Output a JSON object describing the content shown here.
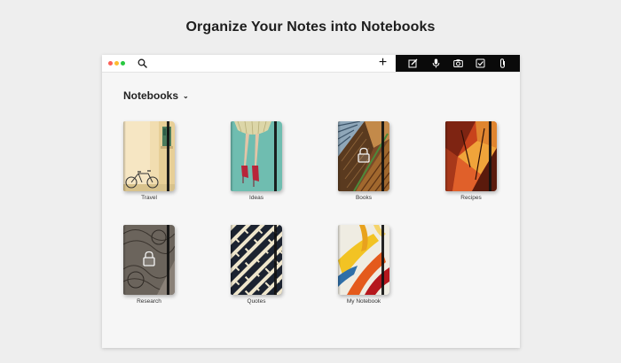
{
  "headline": "Organize Your Notes into Notebooks",
  "colors": {
    "accent_red": "#fc5f57",
    "accent_yellow": "#fdbc2e",
    "accent_green": "#28c840",
    "toolbar_bg": "#0a0a0a"
  },
  "toolbar": {
    "search_icon": "search-icon",
    "add_label": "+",
    "actions": [
      "new-note-icon",
      "microphone-icon",
      "camera-icon",
      "checklist-icon",
      "attachment-icon"
    ]
  },
  "section": {
    "title": "Notebooks",
    "chevron": "⌄"
  },
  "notebooks": [
    {
      "label": "Travel",
      "locked": false
    },
    {
      "label": "Ideas",
      "locked": false
    },
    {
      "label": "Books",
      "locked": true
    },
    {
      "label": "Recipes",
      "locked": false
    },
    {
      "label": "Research",
      "locked": true
    },
    {
      "label": "Quotes",
      "locked": false
    },
    {
      "label": "My Notebook",
      "locked": false
    }
  ]
}
